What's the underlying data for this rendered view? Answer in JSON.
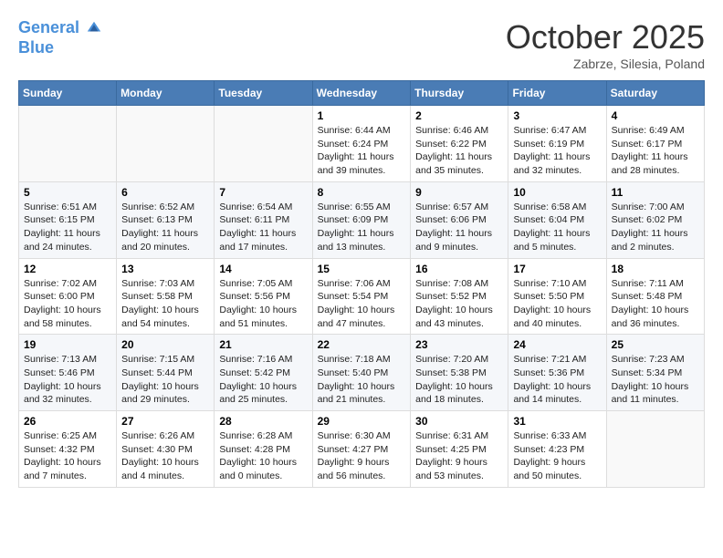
{
  "header": {
    "logo_line1": "General",
    "logo_line2": "Blue",
    "month": "October 2025",
    "location": "Zabrze, Silesia, Poland"
  },
  "weekdays": [
    "Sunday",
    "Monday",
    "Tuesday",
    "Wednesday",
    "Thursday",
    "Friday",
    "Saturday"
  ],
  "weeks": [
    [
      {
        "day": "",
        "info": ""
      },
      {
        "day": "",
        "info": ""
      },
      {
        "day": "",
        "info": ""
      },
      {
        "day": "1",
        "info": "Sunrise: 6:44 AM\nSunset: 6:24 PM\nDaylight: 11 hours\nand 39 minutes."
      },
      {
        "day": "2",
        "info": "Sunrise: 6:46 AM\nSunset: 6:22 PM\nDaylight: 11 hours\nand 35 minutes."
      },
      {
        "day": "3",
        "info": "Sunrise: 6:47 AM\nSunset: 6:19 PM\nDaylight: 11 hours\nand 32 minutes."
      },
      {
        "day": "4",
        "info": "Sunrise: 6:49 AM\nSunset: 6:17 PM\nDaylight: 11 hours\nand 28 minutes."
      }
    ],
    [
      {
        "day": "5",
        "info": "Sunrise: 6:51 AM\nSunset: 6:15 PM\nDaylight: 11 hours\nand 24 minutes."
      },
      {
        "day": "6",
        "info": "Sunrise: 6:52 AM\nSunset: 6:13 PM\nDaylight: 11 hours\nand 20 minutes."
      },
      {
        "day": "7",
        "info": "Sunrise: 6:54 AM\nSunset: 6:11 PM\nDaylight: 11 hours\nand 17 minutes."
      },
      {
        "day": "8",
        "info": "Sunrise: 6:55 AM\nSunset: 6:09 PM\nDaylight: 11 hours\nand 13 minutes."
      },
      {
        "day": "9",
        "info": "Sunrise: 6:57 AM\nSunset: 6:06 PM\nDaylight: 11 hours\nand 9 minutes."
      },
      {
        "day": "10",
        "info": "Sunrise: 6:58 AM\nSunset: 6:04 PM\nDaylight: 11 hours\nand 5 minutes."
      },
      {
        "day": "11",
        "info": "Sunrise: 7:00 AM\nSunset: 6:02 PM\nDaylight: 11 hours\nand 2 minutes."
      }
    ],
    [
      {
        "day": "12",
        "info": "Sunrise: 7:02 AM\nSunset: 6:00 PM\nDaylight: 10 hours\nand 58 minutes."
      },
      {
        "day": "13",
        "info": "Sunrise: 7:03 AM\nSunset: 5:58 PM\nDaylight: 10 hours\nand 54 minutes."
      },
      {
        "day": "14",
        "info": "Sunrise: 7:05 AM\nSunset: 5:56 PM\nDaylight: 10 hours\nand 51 minutes."
      },
      {
        "day": "15",
        "info": "Sunrise: 7:06 AM\nSunset: 5:54 PM\nDaylight: 10 hours\nand 47 minutes."
      },
      {
        "day": "16",
        "info": "Sunrise: 7:08 AM\nSunset: 5:52 PM\nDaylight: 10 hours\nand 43 minutes."
      },
      {
        "day": "17",
        "info": "Sunrise: 7:10 AM\nSunset: 5:50 PM\nDaylight: 10 hours\nand 40 minutes."
      },
      {
        "day": "18",
        "info": "Sunrise: 7:11 AM\nSunset: 5:48 PM\nDaylight: 10 hours\nand 36 minutes."
      }
    ],
    [
      {
        "day": "19",
        "info": "Sunrise: 7:13 AM\nSunset: 5:46 PM\nDaylight: 10 hours\nand 32 minutes."
      },
      {
        "day": "20",
        "info": "Sunrise: 7:15 AM\nSunset: 5:44 PM\nDaylight: 10 hours\nand 29 minutes."
      },
      {
        "day": "21",
        "info": "Sunrise: 7:16 AM\nSunset: 5:42 PM\nDaylight: 10 hours\nand 25 minutes."
      },
      {
        "day": "22",
        "info": "Sunrise: 7:18 AM\nSunset: 5:40 PM\nDaylight: 10 hours\nand 21 minutes."
      },
      {
        "day": "23",
        "info": "Sunrise: 7:20 AM\nSunset: 5:38 PM\nDaylight: 10 hours\nand 18 minutes."
      },
      {
        "day": "24",
        "info": "Sunrise: 7:21 AM\nSunset: 5:36 PM\nDaylight: 10 hours\nand 14 minutes."
      },
      {
        "day": "25",
        "info": "Sunrise: 7:23 AM\nSunset: 5:34 PM\nDaylight: 10 hours\nand 11 minutes."
      }
    ],
    [
      {
        "day": "26",
        "info": "Sunrise: 6:25 AM\nSunset: 4:32 PM\nDaylight: 10 hours\nand 7 minutes."
      },
      {
        "day": "27",
        "info": "Sunrise: 6:26 AM\nSunset: 4:30 PM\nDaylight: 10 hours\nand 4 minutes."
      },
      {
        "day": "28",
        "info": "Sunrise: 6:28 AM\nSunset: 4:28 PM\nDaylight: 10 hours\nand 0 minutes."
      },
      {
        "day": "29",
        "info": "Sunrise: 6:30 AM\nSunset: 4:27 PM\nDaylight: 9 hours\nand 56 minutes."
      },
      {
        "day": "30",
        "info": "Sunrise: 6:31 AM\nSunset: 4:25 PM\nDaylight: 9 hours\nand 53 minutes."
      },
      {
        "day": "31",
        "info": "Sunrise: 6:33 AM\nSunset: 4:23 PM\nDaylight: 9 hours\nand 50 minutes."
      },
      {
        "day": "",
        "info": ""
      }
    ]
  ]
}
